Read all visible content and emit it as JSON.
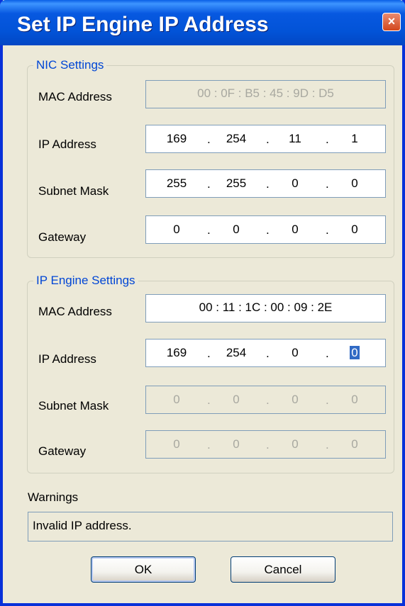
{
  "window": {
    "title": "Set IP Engine IP Address",
    "close_label": "×"
  },
  "nic": {
    "legend": "NIC Settings",
    "mac_label": "MAC Address",
    "mac_value": "00 : 0F : B5 : 45 : 9D : D5",
    "ip_label": "IP Address",
    "ip_octets": [
      "169",
      "254",
      "11",
      "1"
    ],
    "mask_label": "Subnet Mask",
    "mask_octets": [
      "255",
      "255",
      "0",
      "0"
    ],
    "gateway_label": "Gateway",
    "gateway_octets": [
      "0",
      "0",
      "0",
      "0"
    ]
  },
  "engine": {
    "legend": "IP Engine Settings",
    "mac_label": "MAC Address",
    "mac_value": "00 : 11 : 1C : 00 : 09 : 2E",
    "ip_label": "IP Address",
    "ip_octets": [
      "169",
      "254",
      "0",
      "0"
    ],
    "mask_label": "Subnet Mask",
    "mask_octets": [
      "0",
      "0",
      "0",
      "0"
    ],
    "gateway_label": "Gateway",
    "gateway_octets": [
      "0",
      "0",
      "0",
      "0"
    ]
  },
  "warnings": {
    "label": "Warnings",
    "text": "Invalid IP address."
  },
  "buttons": {
    "ok": "OK",
    "cancel": "Cancel"
  },
  "dot": "."
}
